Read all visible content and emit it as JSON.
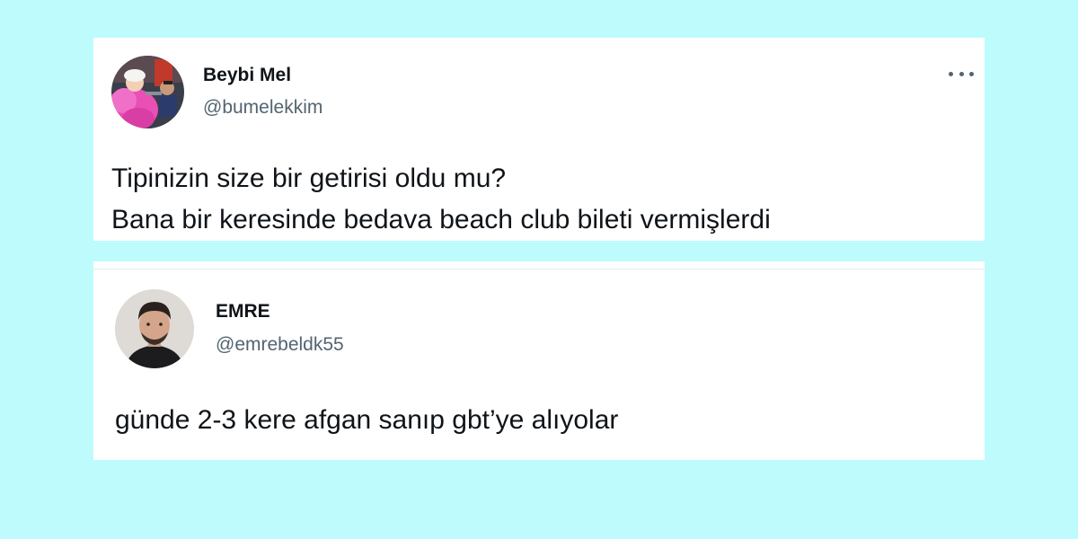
{
  "tweets": [
    {
      "display_name": "Beybi Mel",
      "handle": "@bumelekkim",
      "avatar_icon": "profile-photo-pink-boa",
      "more_icon": "more-options-icon",
      "text_lines": [
        "Tipinizin size bir getirisi oldu mu?",
        "Bana bir keresinde bedava beach club bileti vermişlerdi"
      ]
    },
    {
      "display_name": "EMRE",
      "handle": "@emrebeldk55",
      "avatar_icon": "profile-photo-man",
      "text_lines": [
        "günde 2-3 kere afgan sanıp gbt’ye alıyolar"
      ]
    }
  ],
  "colors": {
    "background": "#bdfbfd",
    "card": "#ffffff",
    "primary_text": "#0f1419",
    "secondary_text": "#536471"
  }
}
